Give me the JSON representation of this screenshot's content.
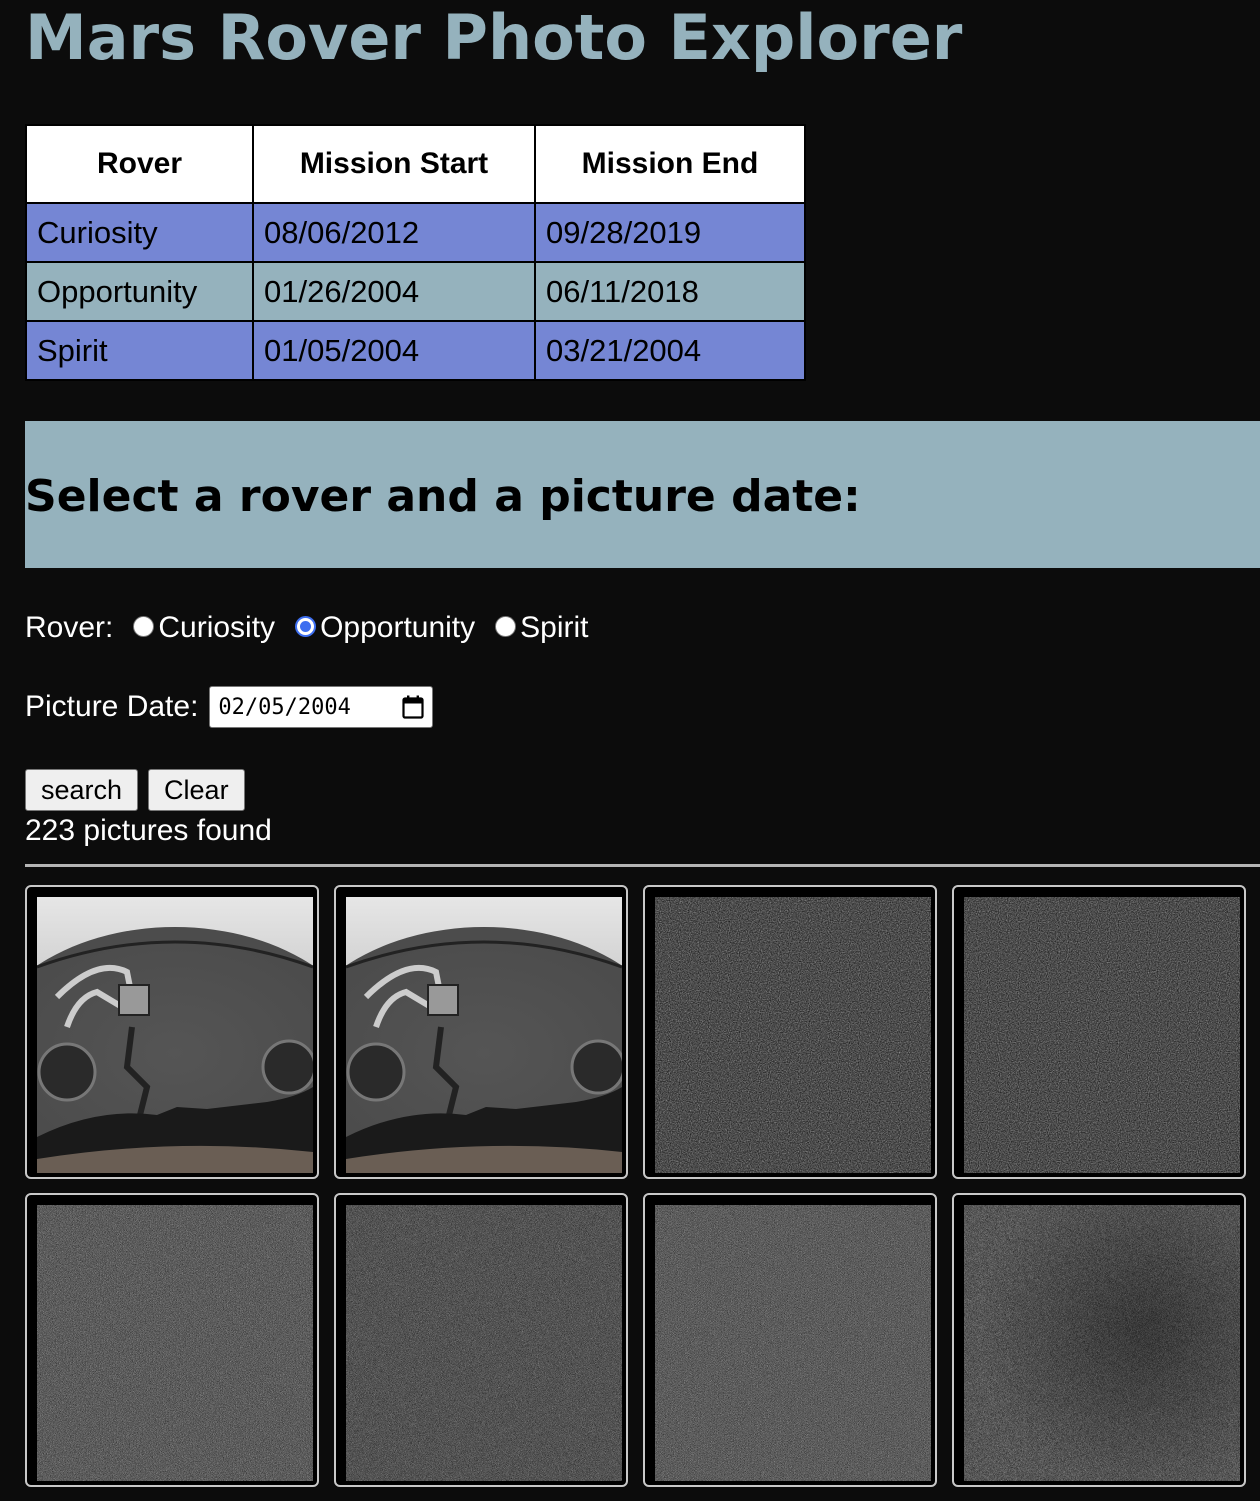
{
  "page": {
    "title": "Mars Rover Photo Explorer"
  },
  "missions_table": {
    "headers": [
      "Rover",
      "Mission Start",
      "Mission End"
    ],
    "rows": [
      {
        "rover": "Curiosity",
        "start": "08/06/2012",
        "end": "09/28/2019"
      },
      {
        "rover": "Opportunity",
        "start": "01/26/2004",
        "end": "06/11/2018"
      },
      {
        "rover": "Spirit",
        "start": "01/05/2004",
        "end": "03/21/2004"
      }
    ]
  },
  "form": {
    "heading": "Select a rover and a picture date:",
    "rover_label": "Rover:",
    "rover_options": [
      "Curiosity",
      "Opportunity",
      "Spirit"
    ],
    "selected_rover": "Opportunity",
    "date_label": "Picture Date:",
    "date_value": "02/05/2004",
    "search_label": "search",
    "clear_label": "Clear"
  },
  "results": {
    "count_text": "223 pictures found",
    "photos": [
      {
        "kind": "arm-fisheye"
      },
      {
        "kind": "arm-fisheye"
      },
      {
        "kind": "soil-dark"
      },
      {
        "kind": "soil-dark"
      },
      {
        "kind": "soil-light"
      },
      {
        "kind": "soil-medium"
      },
      {
        "kind": "soil-light"
      },
      {
        "kind": "soil-shaded"
      }
    ]
  },
  "colors": {
    "background": "#0c0c0c",
    "accent": "#95b2bd",
    "row_blue": "#7586d4",
    "radio_selected": "#3d6ef0"
  },
  "icons": {
    "date_picker": "calendar-icon"
  }
}
